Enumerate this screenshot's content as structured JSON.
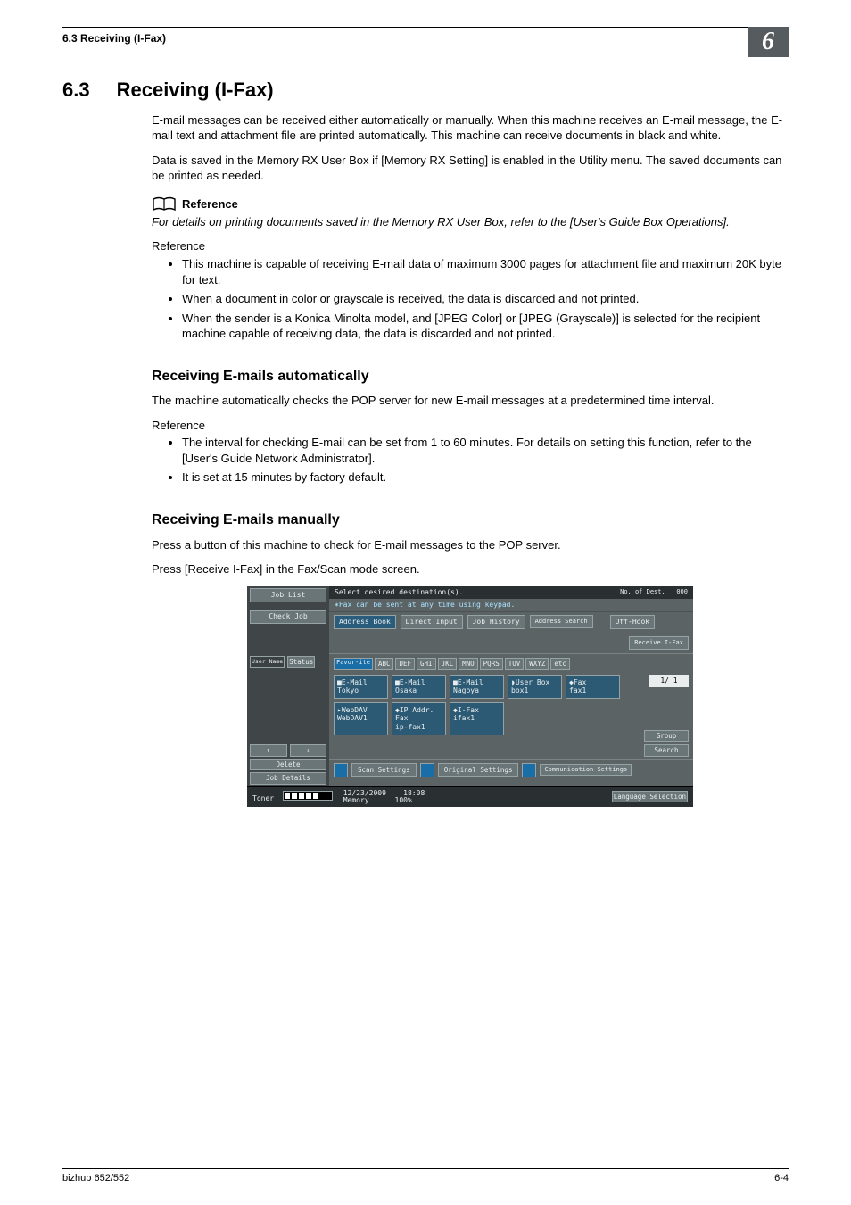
{
  "header": {
    "running_left": "6.3    Receiving (I-Fax)",
    "chapter": "6"
  },
  "section": {
    "num": "6.3",
    "title": "Receiving (I-Fax)",
    "p1": "E-mail messages can be received either automatically or manually. When this machine receives an E-mail message, the E-mail text and attachment file are printed automatically. This machine can receive documents in black and white.",
    "p2": "Data is saved in the Memory RX User Box if [Memory RX Setting] is enabled in the Utility menu. The saved documents can be printed as needed.",
    "ref_heading": "Reference",
    "ref_italic": "For details on printing documents saved in the Memory RX User Box, refer to the [User's Guide Box Operations].",
    "ref_word": "Reference",
    "bullets1": [
      "This machine is capable of receiving E-mail data of maximum 3000 pages for attachment file and maximum 20K byte for text.",
      "When a document in color or grayscale is received, the data is discarded and not printed.",
      "When the sender is a Konica Minolta model, and [JPEG Color] or [JPEG (Grayscale)] is selected for the recipient machine capable of receiving data, the data is discarded and not printed."
    ]
  },
  "auto": {
    "heading": "Receiving E-mails automatically",
    "p1": "The machine automatically checks the POP server for new E-mail messages at a predetermined time interval.",
    "ref_word": "Reference",
    "bullets": [
      "The interval for checking E-mail can be set from 1 to 60 minutes. For details on setting this function, refer to the [User's Guide Network Administrator].",
      "It is set at 15 minutes by factory default."
    ]
  },
  "manual": {
    "heading": "Receiving E-mails manually",
    "p1": "Press a button of this machine to check for E-mail messages to the POP server.",
    "p2": "Press [Receive I-Fax] in the Fax/Scan mode screen."
  },
  "shot": {
    "left": {
      "job_list": "Job List",
      "check_job": "Check Job",
      "user": "User Name",
      "status": "Status",
      "up": "↑",
      "down": "↓",
      "delete": "Delete",
      "details": "Job Details"
    },
    "top": {
      "instruction": "Select desired destination(s).",
      "no_dest_label": "No. of Dest.",
      "no_dest_val": "000",
      "hint": "✶Fax can be sent at any time using keypad."
    },
    "tabs": {
      "addrbook": "Address Book",
      "direct": "Direct Input",
      "history": "Job History",
      "search": "Address Search",
      "offhook": "Off-Hook",
      "receive": "Receive I-Fax"
    },
    "alpha": [
      "Favor-ite",
      "ABC",
      "DEF",
      "GHI",
      "JKL",
      "MNO",
      "PQRS",
      "TUV",
      "WXYZ",
      "etc"
    ],
    "cards_row1": [
      {
        "t1": "■E-Mail",
        "t2": "Tokyo"
      },
      {
        "t1": "■E-Mail",
        "t2": "Osaka"
      },
      {
        "t1": "■E-Mail",
        "t2": "Nagoya"
      },
      {
        "t1": "◗User Box",
        "t2": "box1"
      },
      {
        "t1": "◆Fax",
        "t2": "fax1"
      }
    ],
    "cards_row2": [
      {
        "t1": "▸WebDAV",
        "t2": "WebDAV1"
      },
      {
        "t1": "◆IP Addr. Fax",
        "t2": "ip-fax1"
      },
      {
        "t1": "◆I-Fax",
        "t2": "ifax1"
      }
    ],
    "pager": "1/  1",
    "side": {
      "group": "Group",
      "search": "Search"
    },
    "bottom": {
      "scan": "Scan Settings",
      "orig": "Original Settings",
      "comm": "Communication Settings"
    },
    "status": {
      "toner": "Toner",
      "date": "12/23/2009",
      "time": "18:08",
      "memory": "Memory",
      "mem_val": "100%",
      "lang": "Language Selection"
    }
  },
  "footer": {
    "left": "bizhub 652/552",
    "right": "6-4"
  }
}
